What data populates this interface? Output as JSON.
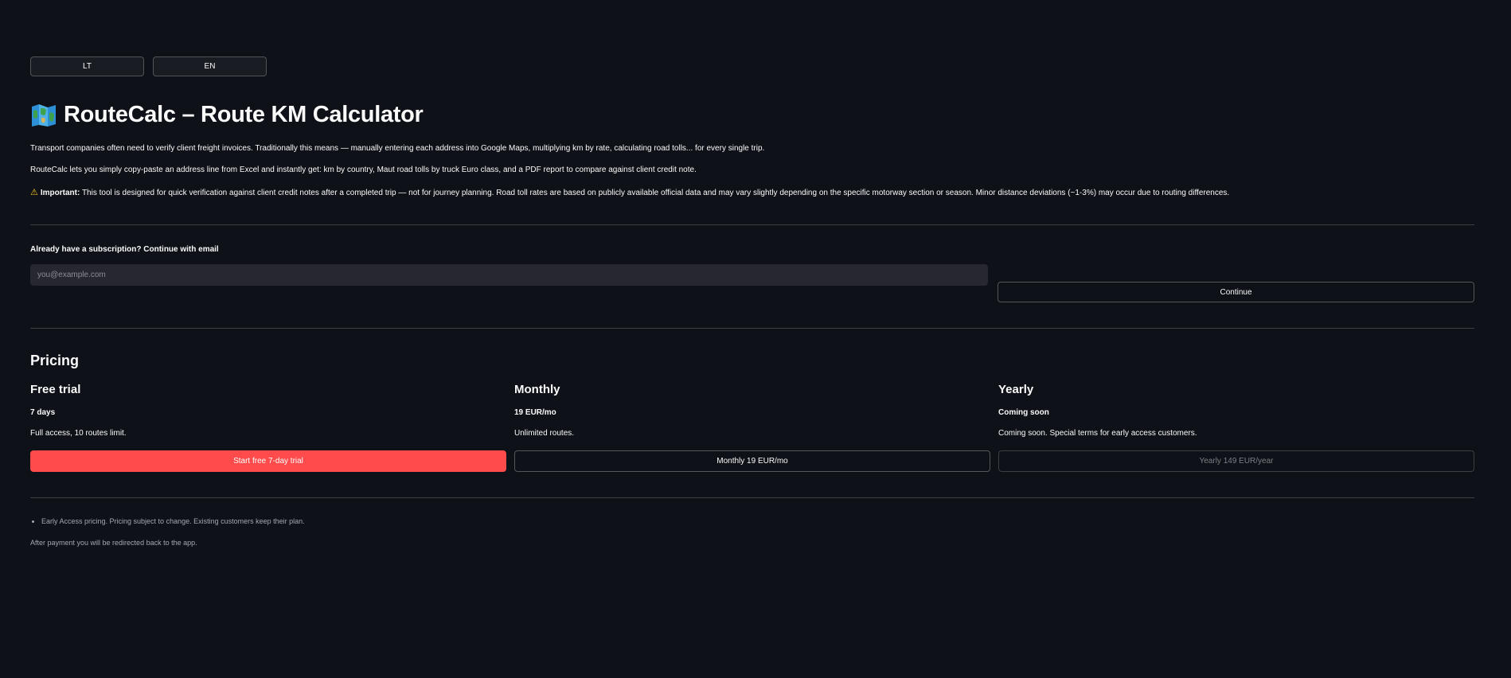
{
  "language_buttons": [
    "LT",
    "EN"
  ],
  "header": {
    "title": "RouteCalc – Route KM Calculator",
    "icon": "folded-map-icon"
  },
  "intro": {
    "paragraph1": "Transport companies often need to verify client freight invoices. Traditionally this means — manually entering each address into Google Maps, multiplying km by rate, calculating road tolls... for every single trip.",
    "paragraph2": "RouteCalc lets you simply copy-paste an address line from Excel and instantly get: km by country, Maut road tolls by truck Euro class, and a PDF report to compare against client credit note.",
    "warning_symbol": "⚠",
    "warning_label": "Important:",
    "warning_text": "This tool is designed for quick verification against client credit notes after a completed trip — not for journey planning. Road toll rates are based on publicly available official data and may vary slightly depending on the specific motorway section or season. Minor distance deviations (~1-3%) may occur due to routing differences."
  },
  "login": {
    "label": "Already have a subscription? Continue with email",
    "placeholder": "you@example.com",
    "value": "",
    "button": "Continue"
  },
  "pricing": {
    "heading": "Pricing",
    "plans": [
      {
        "name": "Free trial",
        "price": "7 days",
        "description": "Full access, 10 routes limit.",
        "button": "Start free 7-day trial",
        "style": "primary"
      },
      {
        "name": "Monthly",
        "price": "19 EUR/mo",
        "description": "Unlimited routes.",
        "button": "Monthly 19 EUR/mo",
        "style": "secondary"
      },
      {
        "name": "Yearly",
        "price": "Coming soon",
        "description": "Coming soon. Special terms for early access customers.",
        "button": "Yearly 149 EUR/year",
        "style": "disabled"
      }
    ]
  },
  "footer": {
    "notes": [
      "Early Access pricing. Pricing subject to change. Existing customers keep their plan."
    ],
    "after_payment": "After payment you will be redirected back to the app."
  },
  "colors": {
    "background": "#0e1117",
    "primary": "#ff4b4b",
    "input_bg": "#262730",
    "warning": "#f5c518"
  }
}
